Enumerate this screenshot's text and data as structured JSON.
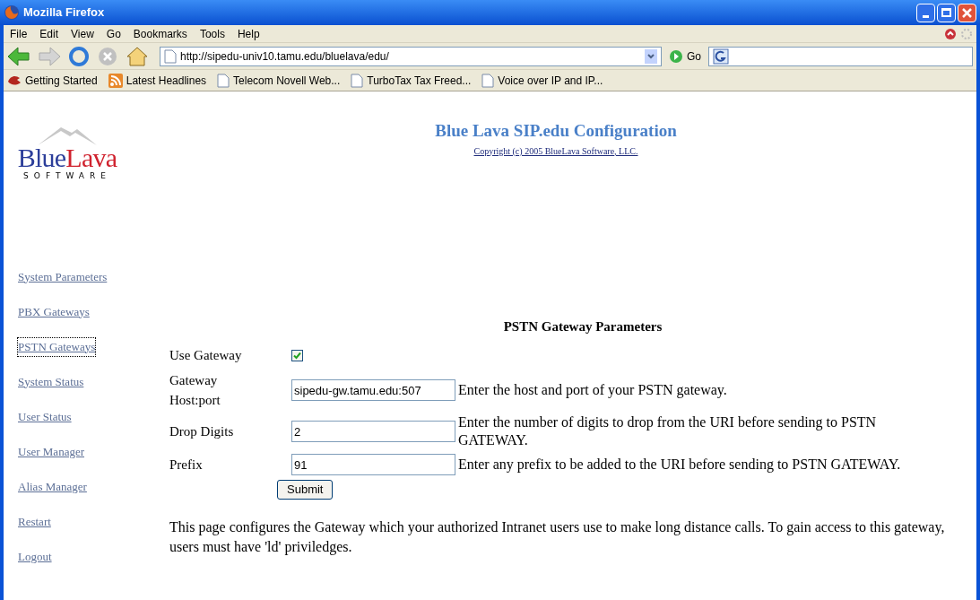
{
  "window": {
    "title": "Mozilla Firefox"
  },
  "menu": [
    "File",
    "Edit",
    "View",
    "Go",
    "Bookmarks",
    "Tools",
    "Help"
  ],
  "address": {
    "value": "http://sipedu-univ10.tamu.edu/bluelava/edu/",
    "go": "Go"
  },
  "bookmarks": [
    {
      "label": "Getting Started",
      "kind": "start"
    },
    {
      "label": "Latest Headlines",
      "kind": "feed"
    },
    {
      "label": "Telecom Novell Web...",
      "kind": "page"
    },
    {
      "label": "TurboTax Tax Freed...",
      "kind": "page"
    },
    {
      "label": "Voice over IP and IP...",
      "kind": "page"
    }
  ],
  "logo": {
    "first": "Blue",
    "second": "Lava",
    "tagline": "SOFTWARE"
  },
  "header": {
    "title": "Blue Lava SIP.edu Configuration",
    "copyright": "Copyright (c) 2005 BlueLava Software, LLC."
  },
  "sidebar": {
    "items": [
      {
        "label": "System Parameters",
        "selected": false
      },
      {
        "label": "PBX Gateways",
        "selected": false
      },
      {
        "label": "PSTN Gateways",
        "selected": true
      },
      {
        "label": "System Status",
        "selected": false
      },
      {
        "label": "User Status",
        "selected": false
      },
      {
        "label": "User Manager",
        "selected": false
      },
      {
        "label": "Alias Manager",
        "selected": false
      },
      {
        "label": "Restart",
        "selected": false
      },
      {
        "label": "Logout",
        "selected": false
      }
    ]
  },
  "form": {
    "heading": "PSTN Gateway Parameters",
    "rows": [
      {
        "kind": "checkbox",
        "label": "Use Gateway",
        "checked": true
      },
      {
        "kind": "text",
        "label": "Gateway Host:port",
        "value": "sipedu-gw.tamu.edu:507",
        "help": "Enter the host and port of your PSTN gateway."
      },
      {
        "kind": "text",
        "label": "Drop Digits",
        "value": "2",
        "help": "Enter the number of digits to drop from the URI before sending to PSTN GATEWAY."
      },
      {
        "kind": "text",
        "label": "Prefix",
        "value": "91",
        "help": "Enter any prefix to be added to the URI before sending to PSTN GATEWAY."
      }
    ],
    "submit": "Submit"
  },
  "note": "This page configures the Gateway which your authorized Intranet users use to make long distance calls. To gain access to this gateway, users must have 'ld' priviledges."
}
